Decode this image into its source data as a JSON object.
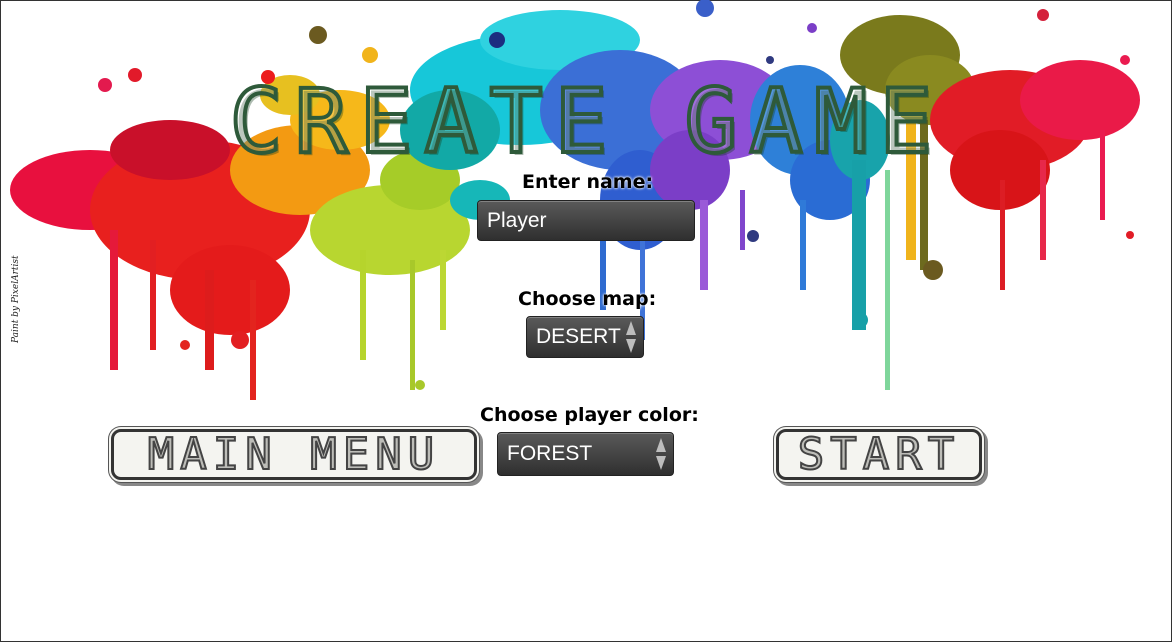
{
  "title": "CREATE GAME",
  "credit": "Paint by PixelArtist",
  "name": {
    "label": "Enter name:",
    "value": "Player"
  },
  "map": {
    "label": "Choose map:",
    "value": "DESERT"
  },
  "color": {
    "label": "Choose player color:",
    "value": "FOREST"
  },
  "buttons": {
    "main_menu": "MAIN MENU",
    "start": "START"
  },
  "icons": {
    "spinner": "up-down-arrows-icon"
  },
  "colors": {
    "title_stroke": "#2e5a3a",
    "field_bg": "#3f3f3f",
    "button_bg": "#f4f4f0"
  }
}
